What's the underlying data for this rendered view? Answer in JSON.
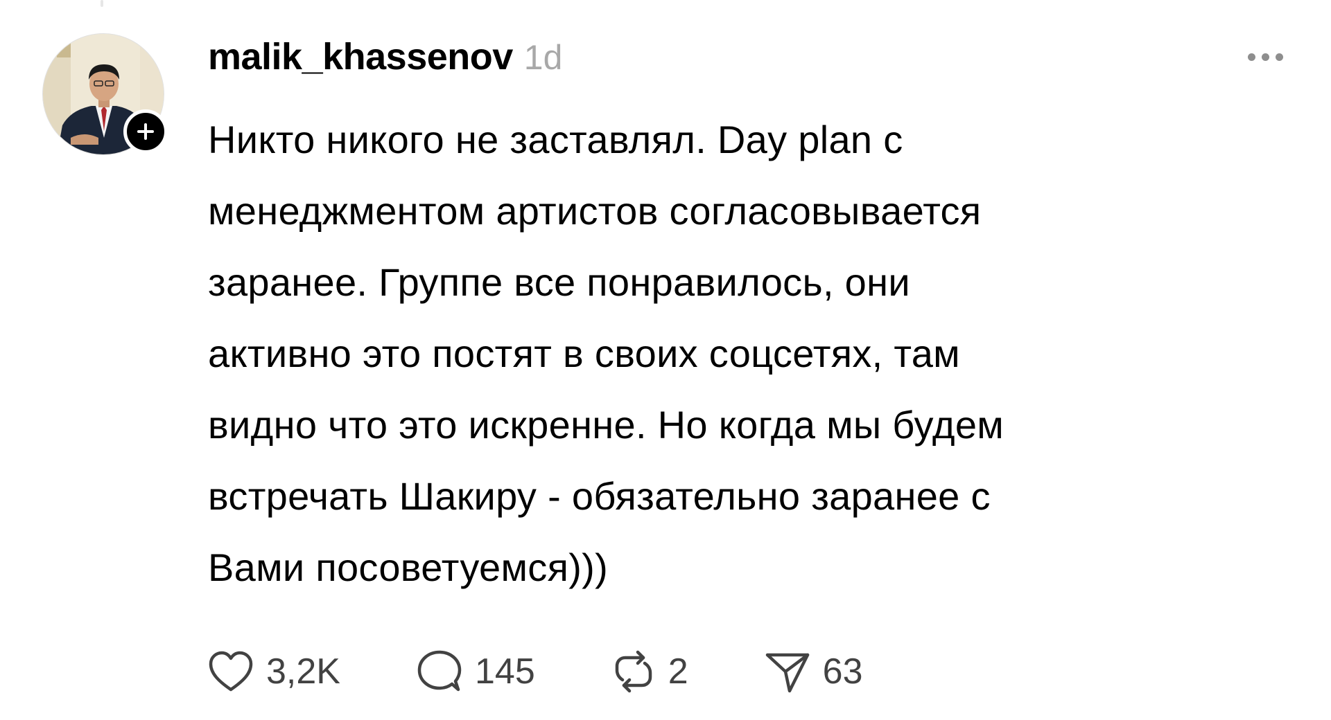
{
  "post": {
    "author": {
      "username": "malik_khassenov",
      "avatar_icon": "profile-photo-man-in-suit",
      "follow_icon": "plus-icon"
    },
    "timestamp": "1d",
    "more_icon": "ellipsis-icon",
    "text_lines": [
      "Никто никого не заставлял. Day plan с",
      "менеджментом артистов согласовывается",
      "заранее. Группе все понравилось, они",
      "активно это постят в своих соцсетях, там",
      "видно что это искренне. Но когда мы будем",
      "встречать Шакиру - обязательно заранее с",
      "Вами посоветуемся)))"
    ],
    "actions": {
      "likes": {
        "icon": "heart-icon",
        "count": "3,2K"
      },
      "replies": {
        "icon": "comment-icon",
        "count": "145"
      },
      "reposts": {
        "icon": "repost-icon",
        "count": "2"
      },
      "shares": {
        "icon": "share-icon",
        "count": "63"
      }
    }
  },
  "colors": {
    "text": "#000000",
    "muted": "#a8a8a8",
    "action_text": "#424242",
    "icon": "#424242",
    "badge": "#000000"
  }
}
